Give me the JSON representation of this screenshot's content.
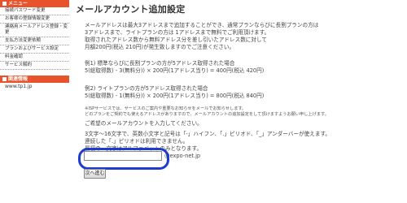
{
  "sidebar": {
    "header": "メニュー",
    "items": [
      "接続パスワード変更",
      "お客様の登録情報変更",
      "連絡用メールアドレス登録・変更",
      "支払方法変更依頼",
      "プランおよびサービス設定",
      "料金確認",
      "サービス解約"
    ],
    "related_header": "関連情報",
    "related_link": "www.tp1.jp"
  },
  "main": {
    "title": "メールアカウント追加設定",
    "intro": [
      "メールアドレスは最大3アドレスまで追加することができ、通常プランならびに長割プランの方は",
      "3アドレスまで、ライトプランの方は 1アドレスまで無料でご利用頂けます。",
      "取得されたアドレス数から無料アドレス分を差し引いたアドレス数に対して",
      "月額200円(税込 210円)が発生致しますのでご注意ください。"
    ],
    "example1": [
      "例1) 標準ならびに長割プランの方が5アドレス取得された場合",
      "5(総取得数) - 3(無料分)) × 200円(1アドレス当り) = 400円(税込 420円)"
    ],
    "example2": [
      "例2) ライトプランの方が5アドレス取得された場合",
      "5(総取得数) - 1(無料分)) × 200円(1アドレス当り) = 800円(税込 840円)"
    ],
    "notes": [
      "※ISPサービスでは、サービスのご案内や重要なお知らせをメールでお知らせします。",
      "どのプランをご契約でも使えるアドレスがありますので、メールアカウントの追加設定をして頂けますようお願い申し上げます。"
    ],
    "prompt": "ご希望のメールアカウントを入力してください。",
    "rules": [
      "3文字〜16文字で、英数小文字と記号は「-」ハイフン、「.」ピリオド、「_」アンダーバーが使えます。",
      "連続した「.」ピリオドは利用できません。",
      "最初の一文字はアルファベットのみとなります。"
    ],
    "email_value": "",
    "email_placeholder": "",
    "domain": "@expo-net.jp",
    "next_label": "次へ進む"
  }
}
